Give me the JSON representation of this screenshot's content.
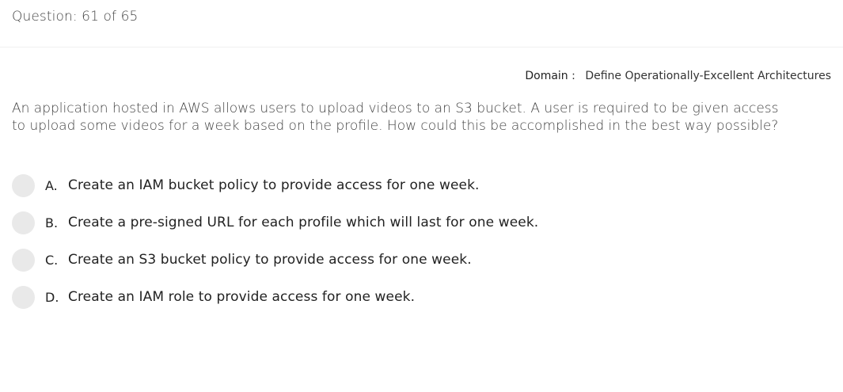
{
  "header": {
    "question_counter": "Question: 61 of 65"
  },
  "domain": {
    "label": "Domain",
    "separator": ":",
    "value": "Define Operationally-Excellent Architectures"
  },
  "question": {
    "text": "An application hosted in AWS allows users to upload videos to an S3 bucket. A user is required to be given access to upload some videos for a week based on the profile. How could this be accomplished in the best way possible?"
  },
  "options": [
    {
      "letter": "A.",
      "text": "Create an IAM bucket policy to provide access for one week."
    },
    {
      "letter": "B.",
      "text": "Create a pre-signed URL for each profile which will last for one week."
    },
    {
      "letter": "C.",
      "text": "Create an S3 bucket policy to provide access for one week."
    },
    {
      "letter": "D.",
      "text": "Create an IAM role to provide access for one week."
    }
  ],
  "colors": {
    "radio_fill": "#e9e9e9",
    "text_primary": "#222222",
    "text_light": "#444444"
  }
}
